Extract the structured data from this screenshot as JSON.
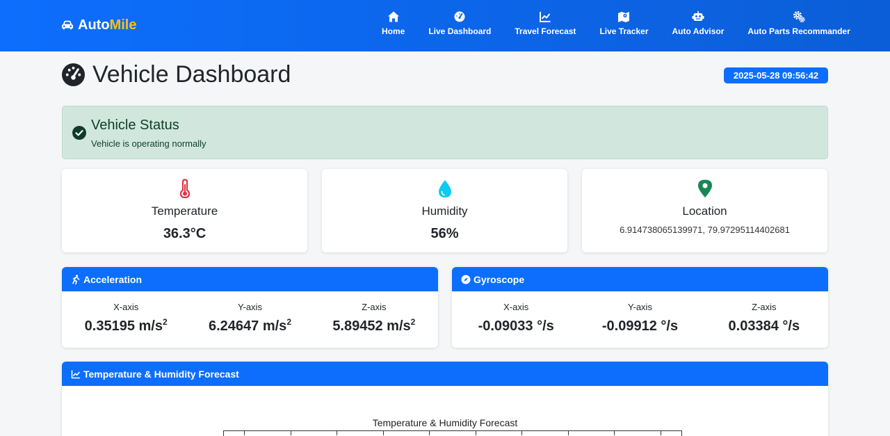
{
  "brand": {
    "prefix": "Auto",
    "accent": "Mile"
  },
  "nav": [
    {
      "label": "Home",
      "icon": "home-icon"
    },
    {
      "label": "Live Dashboard",
      "icon": "gauge-icon"
    },
    {
      "label": "Travel Forecast",
      "icon": "chart-line-icon"
    },
    {
      "label": "Live Tracker",
      "icon": "map-icon"
    },
    {
      "label": "Auto Advisor",
      "icon": "robot-icon"
    },
    {
      "label": "Auto Parts Recommander",
      "icon": "gears-icon"
    }
  ],
  "page": {
    "title": "Vehicle Dashboard",
    "timestamp": "2025-05-28 09:56:42"
  },
  "alert": {
    "title": "Vehicle Status",
    "message": "Vehicle is operating normally"
  },
  "stats": {
    "temperature": {
      "label": "Temperature",
      "value": "36.3°C"
    },
    "humidity": {
      "label": "Humidity",
      "value": "56%"
    },
    "location": {
      "label": "Location",
      "value": "6.914738065139971, 79.97295114402681"
    }
  },
  "acceleration": {
    "title": "Acceleration",
    "x_label": "X-axis",
    "x_value": "0.35195 m/s",
    "y_label": "Y-axis",
    "y_value": "6.24647 m/s",
    "z_label": "Z-axis",
    "z_value": "5.89452 m/s",
    "unit_sup": "2"
  },
  "gyroscope": {
    "title": "Gyroscope",
    "x_label": "X-axis",
    "x_value": "-0.09033 °/s",
    "y_label": "Y-axis",
    "y_value": "-0.09912 °/s",
    "z_label": "Z-axis",
    "z_value": "0.03384 °/s"
  },
  "forecast": {
    "panel_title": "Temperature & Humidity Forecast",
    "chart_title": "Temperature & Humidity Forecast"
  },
  "colors": {
    "primary": "#0d6efd",
    "brand_accent": "#ffc107",
    "success_bg": "#d1e7dd",
    "temperature_icon": "#dc3545",
    "humidity_icon": "#0dcaf0",
    "location_icon": "#198754"
  }
}
